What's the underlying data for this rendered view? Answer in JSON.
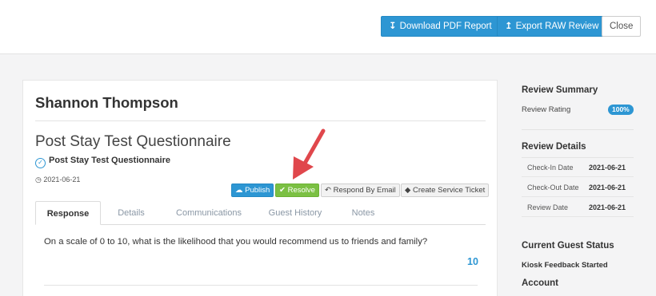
{
  "toolbar": {
    "download_pdf": "Download PDF Report",
    "export_raw": "Export RAW Review",
    "close": "Close"
  },
  "review": {
    "guest_name": "Shannon Thompson",
    "questionnaire_title": "Post Stay Test Questionnaire",
    "questionnaire_subtitle": "Post Stay Test Questionnaire",
    "date": "2021-06-21"
  },
  "actions": {
    "publish": "Publish",
    "resolve": "Resolve",
    "respond_email": "Respond By Email",
    "create_ticket": "Create Service Ticket"
  },
  "tabs": [
    {
      "label": "Response",
      "active": true
    },
    {
      "label": "Details",
      "active": false
    },
    {
      "label": "Communications",
      "active": false
    },
    {
      "label": "Guest History",
      "active": false
    },
    {
      "label": "Notes",
      "active": false
    }
  ],
  "response": {
    "question": "On a scale of 0 to 10, what is the likelihood that you would recommend us to friends and family?",
    "answer": "10"
  },
  "sidebar": {
    "summary_heading": "Review Summary",
    "rating_label": "Review Rating",
    "rating_value": "100%",
    "details_heading": "Review Details",
    "details": [
      {
        "label": "Check-In Date",
        "value": "2021-06-21"
      },
      {
        "label": "Check-Out Date",
        "value": "2021-06-21"
      },
      {
        "label": "Review Date",
        "value": "2021-06-21"
      }
    ],
    "guest_status_heading": "Current Guest Status",
    "guest_status": "Kiosk Feedback Started",
    "account_heading": "Account"
  },
  "colors": {
    "accent_blue": "#2d96d3",
    "resolve_green": "#7bc043",
    "arrow_red": "#e0474c"
  },
  "icons": {
    "download": "download-icon",
    "export": "upload-icon",
    "publish": "cloud-upload-icon",
    "resolve": "checkmark-icon",
    "respond": "reply-icon",
    "ticket": "tag-icon",
    "date": "clock-icon",
    "questionnaire": "badge-check-icon"
  }
}
